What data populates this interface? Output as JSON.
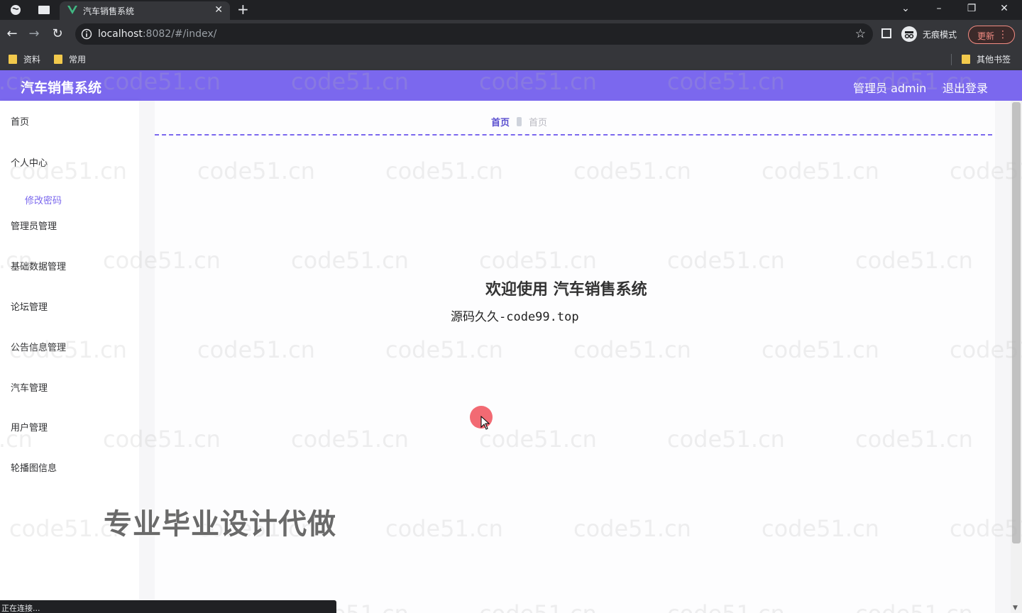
{
  "browser": {
    "tab_title": "汽车销售系统",
    "url_host": "localhost",
    "url_rest": ":8082/#/index/",
    "incognito_label": "无痕模式",
    "update_label": "更新",
    "bookmarks": [
      "资料",
      "常用"
    ],
    "other_bookmarks": "其他书签",
    "status_text": "正在连接..."
  },
  "header": {
    "title": "汽车销售系统",
    "admin_label": "管理员 admin",
    "logout_label": "退出登录"
  },
  "sidebar": {
    "items": [
      {
        "label": "首页"
      },
      {
        "label": "个人中心"
      },
      {
        "label": "修改密码"
      },
      {
        "label": "管理员管理"
      },
      {
        "label": "基础数据管理"
      },
      {
        "label": "论坛管理"
      },
      {
        "label": "公告信息管理"
      },
      {
        "label": "汽车管理"
      },
      {
        "label": "用户管理"
      },
      {
        "label": "轮播图信息"
      }
    ]
  },
  "main": {
    "breadcrumb": {
      "home": "首页",
      "current": "首页"
    },
    "welcome": "欢迎使用 汽车销售系统",
    "subline": "源码久久-code99.top"
  },
  "overlay": {
    "watermark": "code51.cn",
    "ad_text": "专业毕业设计代做"
  },
  "colors": {
    "header": "#7b68ee",
    "accent": "#7b68ee",
    "chrome_dark": "#202124",
    "chrome": "#35363a"
  }
}
